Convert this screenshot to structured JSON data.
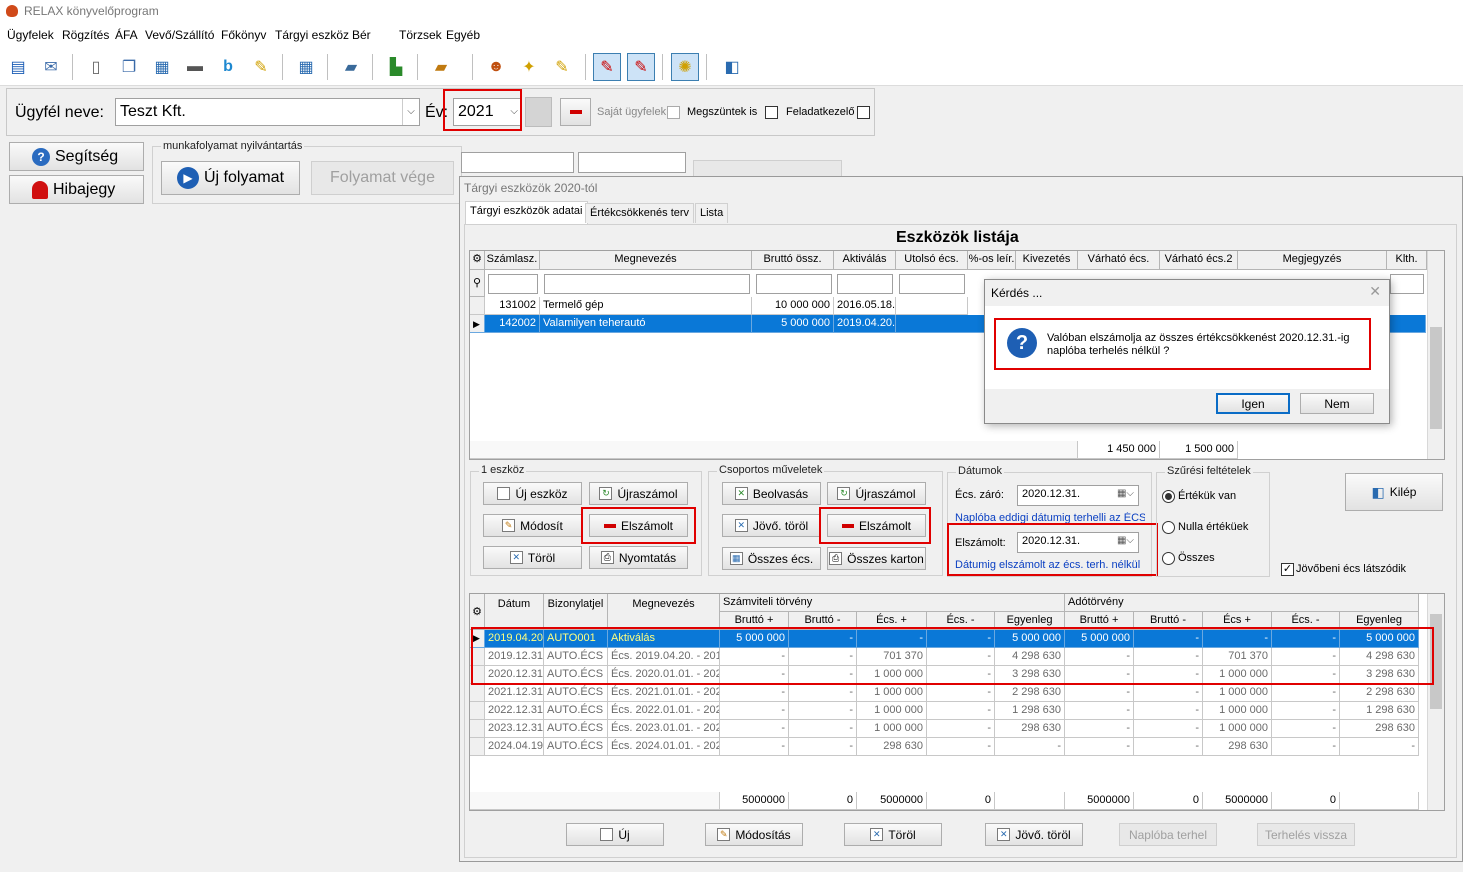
{
  "app": {
    "title": "RELAX könyvelőprogram"
  },
  "menu": [
    "Ügyfelek",
    "Rögzítés",
    "ÁFA",
    "Vevő/Szállító",
    "Főkönyv",
    "Tárgyi eszköz",
    "Bér",
    "Törzsek",
    "Egyéb"
  ],
  "client_bar": {
    "client_label": "Ügyfél neve:",
    "client_value": "Teszt Kft.",
    "year_label": "Év:",
    "year_value": "2021",
    "own_clients_label": "Saját ügyfelek",
    "terminated_label": "Megszüntek is",
    "task_manager_label": "Feladatkezelő"
  },
  "side_buttons": {
    "help": "Segítség",
    "bug": "Hibajegy"
  },
  "workflow": {
    "group_label": "munkafolyamat nyilvántartás",
    "new_label": "Új folyamat",
    "end_label": "Folyamat vége"
  },
  "window": {
    "title": "Tárgyi eszközök 2020-tól",
    "tabs": [
      "Tárgyi eszközök adatai",
      "Értékcsökkenés terv",
      "Lista"
    ],
    "list_title": "Eszközök listája"
  },
  "assets_table": {
    "columns": [
      "Számlasz.",
      "Megnevezés",
      "Bruttó össz.",
      "Aktiválás",
      "Utolsó écs.",
      "%-os leír.",
      "Kivezetés",
      "Várható écs.",
      "Várható écs.2",
      "Megjegyzés",
      "Klth."
    ],
    "rows": [
      [
        "131002",
        "Termelő gép",
        "10 000 000",
        "2016.05.18."
      ],
      [
        "142002",
        "Valamilyen teherautó",
        "5 000 000",
        "2019.04.20."
      ]
    ],
    "footer_values": [
      "1 450 000",
      "1 500 000"
    ]
  },
  "group_single": {
    "label": "1 eszköz",
    "new": "Új eszköz",
    "recalc": "Újraszámol",
    "modify": "Módosít",
    "settled": "Elszámolt",
    "delete": "Töröl",
    "print": "Nyomtatás"
  },
  "group_bulk": {
    "label": "Csoportos műveletek",
    "import": "Beolvasás",
    "recalc": "Újraszámol",
    "future_delete": "Jövő. töröl",
    "settled": "Elszámolt",
    "all_dep": "Összes écs.",
    "all_card": "Összes karton"
  },
  "dates": {
    "label": "Dátumok",
    "close_label": "Écs. záró:",
    "close_value": "2020.12.31.",
    "note1": "Naplóba eddigi dátumig terhelli az ÉCS-t",
    "settled_label": "Elszámolt:",
    "settled_value": "2020.12.31.",
    "note2": "Dátumig elszámolt az écs. terh. nélkül"
  },
  "filter": {
    "label": "Szűrési feltételek",
    "options": [
      "Értékük van",
      "Nulla értéküek",
      "Összes"
    ],
    "selected": 0,
    "future_dep_label": "Jövőbeni écs látszódik"
  },
  "exit_label": "Kilép",
  "dialog": {
    "title": "Kérdés ...",
    "message_line1": "Valóban elszámolja az összes értékcsökkenést 2020.12.31.-ig",
    "message_line2": "naplóba terhelés nélkül ?",
    "yes": "Igen",
    "no": "Nem"
  },
  "ledger": {
    "group_headers": {
      "accounting": "Számviteli törvény",
      "tax": "Adótörvény"
    },
    "columns": [
      "Dátum",
      "Bizonylatjel",
      "Megnevezés",
      "Bruttó +",
      "Bruttó -",
      "Écs. +",
      "Écs. -",
      "Egyenleg",
      "Bruttó +",
      "Bruttó -",
      "Écs +",
      "Écs. -",
      "Egyenleg"
    ],
    "rows": [
      [
        "2019.04.20.",
        "AUTO001",
        "Aktiválás",
        "5 000 000",
        "-",
        "-",
        "-",
        "5 000 000",
        "5 000 000",
        "-",
        "-",
        "-",
        "5 000 000"
      ],
      [
        "2019.12.31.",
        "AUTO.ÉCS",
        "Écs. 2019.04.20. - 201",
        "-",
        "-",
        "701 370",
        "-",
        "4 298 630",
        "-",
        "-",
        "701 370",
        "-",
        "4 298 630"
      ],
      [
        "2020.12.31.",
        "AUTO.ÉCS",
        "Écs. 2020.01.01. - 202",
        "-",
        "-",
        "1 000 000",
        "-",
        "3 298 630",
        "-",
        "-",
        "1 000 000",
        "-",
        "3 298 630"
      ],
      [
        "2021.12.31.",
        "AUTO.ÉCS",
        "Écs. 2021.01.01. - 202",
        "-",
        "-",
        "1 000 000",
        "-",
        "2 298 630",
        "-",
        "-",
        "1 000 000",
        "-",
        "2 298 630"
      ],
      [
        "2022.12.31.",
        "AUTO.ÉCS",
        "Écs. 2022.01.01. - 202",
        "-",
        "-",
        "1 000 000",
        "-",
        "1 298 630",
        "-",
        "-",
        "1 000 000",
        "-",
        "1 298 630"
      ],
      [
        "2023.12.31.",
        "AUTO.ÉCS",
        "Écs. 2023.01.01. - 202",
        "-",
        "-",
        "1 000 000",
        "-",
        "298 630",
        "-",
        "-",
        "1 000 000",
        "-",
        "298 630"
      ],
      [
        "2024.04.19.",
        "AUTO.ÉCS",
        "Écs. 2024.01.01. - 202",
        "-",
        "-",
        "298 630",
        "-",
        "-",
        "-",
        "-",
        "298 630",
        "-",
        "-"
      ]
    ],
    "totals": [
      "5000000",
      "0",
      "5000000",
      "0",
      "5000000",
      "0",
      "5000000",
      "0"
    ]
  },
  "bottom_buttons": {
    "new": "Új",
    "modify": "Módosítás",
    "delete": "Töröl",
    "future_delete": "Jövő. töröl",
    "post_journal": "Naplóba terhel",
    "undo_post": "Terhelés vissza"
  },
  "colors": {
    "selection": "#0a78d7",
    "highlight_box": "#e00000",
    "question_icon": "#1e5fb4"
  }
}
